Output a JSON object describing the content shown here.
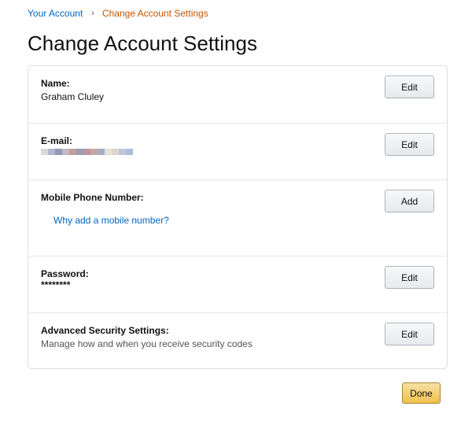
{
  "breadcrumb": {
    "parent": "Your Account",
    "separator": "›",
    "current": "Change Account Settings"
  },
  "page_title": "Change Account Settings",
  "settings": {
    "name": {
      "label": "Name:",
      "value": "Graham Cluley",
      "button": "Edit"
    },
    "email": {
      "label": "E-mail:",
      "button": "Edit",
      "obscured_colors": [
        "#d9d7de",
        "#b8b7c9",
        "#8f9bb8",
        "#c5b8c0",
        "#bba0a0",
        "#9b9db5",
        "#b89a9a",
        "#c7a7a0",
        "#a5adc5",
        "#e6e0dc",
        "#dcd4cf",
        "#bdc6d9",
        "#a9bfdc"
      ]
    },
    "mobile": {
      "label": "Mobile Phone Number:",
      "link": "Why add a mobile number?",
      "button": "Add"
    },
    "password": {
      "label": "Password:",
      "value": "********",
      "button": "Edit"
    },
    "advanced": {
      "label": "Advanced Security Settings:",
      "description": "Manage how and when you receive security codes",
      "button": "Edit"
    }
  },
  "done_button": "Done",
  "colors": {
    "link": "#0066c0",
    "breadcrumb_current": "#c45500",
    "done_button": "#f0c14b"
  }
}
